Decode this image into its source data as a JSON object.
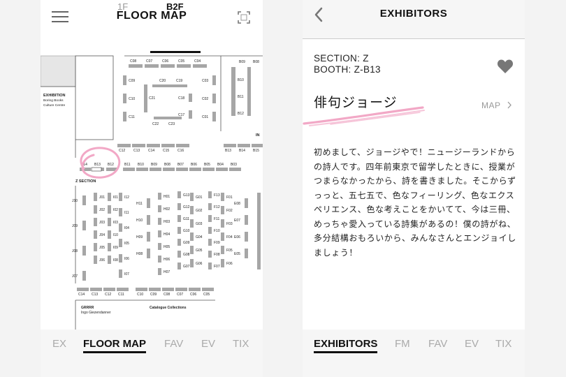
{
  "left": {
    "title": "FLOOR MAP",
    "floors": [
      "1F",
      "B2F"
    ],
    "active_floor": "B2F",
    "nav": [
      "EX",
      "FLOOR MAP",
      "FAV",
      "EV",
      "TIX"
    ],
    "active_nav": "FLOOR MAP",
    "map": {
      "exhibition_text": [
        "EXHIBITION",
        "Boring Books",
        "Culture Centre"
      ],
      "in_label": "IN",
      "z_section": "Z SECTION",
      "grrrr": [
        "GRRRR",
        "Ingo Giezendanner"
      ],
      "catalogue": "Catalogue Collections",
      "booths": {
        "c_top_row": [
          "C08",
          "C07",
          "C06",
          "C05",
          "C04"
        ],
        "c_inner_top": [
          "C20",
          "C19"
        ],
        "c_inner_bottom": [
          "C22",
          "C23"
        ],
        "c_inner_left": "C21",
        "c_col_left": [
          "C09",
          "C10",
          "C11"
        ],
        "c_col_mid": [
          "C18",
          "C17"
        ],
        "c_col_right": [
          "C03",
          "C02",
          "C01"
        ],
        "b_col": [
          "B09",
          "B08",
          "B10",
          "B11",
          "B12"
        ],
        "c_row_mid": [
          "C12",
          "C13",
          "C14",
          "C15",
          "C16"
        ],
        "b_row_mid": [
          "B13",
          "B14",
          "B15"
        ],
        "z_row": [
          "B14",
          "B13",
          "B12"
        ],
        "b_row": [
          "B11",
          "B10",
          "B09",
          "B08",
          "B07",
          "B06",
          "B05",
          "B04",
          "B03"
        ],
        "j_left": [
          "J10",
          "J09",
          "J08",
          "J07"
        ],
        "j_right": [
          "J01",
          "J02",
          "J03",
          "J04",
          "J05",
          "J06"
        ],
        "i_left": [
          "I01",
          "I02",
          "I03",
          "I10",
          "I09",
          "I08"
        ],
        "i_right": [
          "I12",
          "I11",
          "I04",
          "I05",
          "I06",
          "I07"
        ],
        "h_left": [
          "H11",
          "H10",
          "H09",
          "H08"
        ],
        "h_right": [
          "H01",
          "H02",
          "H03",
          "H04",
          "H05",
          "H06",
          "H07"
        ],
        "g_left": [
          "G13",
          "G12",
          "G11",
          "G10",
          "G09",
          "G08",
          "G07"
        ],
        "g_right": [
          "G01",
          "G02",
          "G03",
          "G04",
          "G05",
          "G06"
        ],
        "f_left": [
          "F13",
          "F12",
          "F11",
          "F10",
          "F09",
          "F08",
          "F07"
        ],
        "f_right": [
          "F01",
          "F02",
          "F03",
          "F04",
          "F05",
          "F06"
        ],
        "e_col": [
          "E08",
          "E07",
          "E06",
          "E05"
        ],
        "c_bottom_left": [
          "C14",
          "C13",
          "C12",
          "C11"
        ],
        "c_bottom_right": [
          "C10",
          "C09",
          "C08",
          "C07",
          "C06",
          "C05"
        ]
      }
    }
  },
  "right": {
    "title": "EXHIBITORS",
    "section": "SECTION: Z",
    "booth": "BOOTH: Z-B13",
    "name": "俳句ジョージ",
    "map_link": "MAP",
    "description": "初めまして、ジョージやで！ニュージーランドからの詩人です。四年前東京で留学したときに、授業がつまらなかったから、詩を書きました。そこからずっっと、五七五で、色なフィーリング、色なエクスペリエンス、色な考えことをかいてて、今は三冊、めっちゃ愛入っている詩集があるの！僕の詩がね、多分結構おもろいから、みんなさんとエンジョイしましょう！",
    "nav": [
      "EXHIBITORS",
      "FM",
      "FAV",
      "EV",
      "TIX"
    ],
    "active_nav": "EXHIBITORS"
  },
  "colors": {
    "booth_grey": "#a6a6a6",
    "highlight_pink": "#f2a8c6",
    "text_dark": "#111111",
    "text_muted": "#aaaaaa"
  },
  "icons": [
    "menu-icon",
    "qr-code-icon",
    "back-arrow-icon",
    "heart-icon",
    "chevron-right-icon"
  ]
}
